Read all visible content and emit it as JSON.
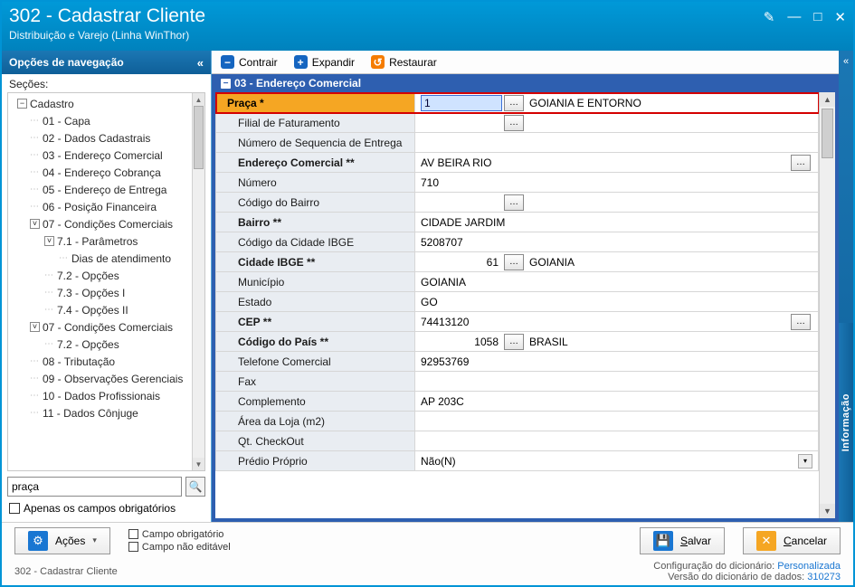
{
  "window": {
    "title": "302 - Cadastrar Cliente",
    "subtitle": "Distribuição e Varejo (Linha WinThor)"
  },
  "nav": {
    "header": "Opções de navegação",
    "sections_label": "Seções:",
    "items": [
      {
        "lv": 0,
        "exp": "-",
        "label": "Cadastro"
      },
      {
        "lv": 1,
        "label": "01 - Capa"
      },
      {
        "lv": 1,
        "label": "02 - Dados Cadastrais"
      },
      {
        "lv": 1,
        "label": "03 - Endereço Comercial"
      },
      {
        "lv": 1,
        "label": "04 - Endereço Cobrança"
      },
      {
        "lv": 1,
        "label": "05 - Endereço de Entrega"
      },
      {
        "lv": 1,
        "label": "06 - Posição Financeira"
      },
      {
        "lv": 1,
        "exp": "v",
        "label": "07 - Condições Comerciais"
      },
      {
        "lv": 2,
        "exp": "v",
        "label": "7.1 - Parâmetros"
      },
      {
        "lv": 3,
        "label": "Dias de atendimento"
      },
      {
        "lv": 2,
        "label": "7.2 - Opções"
      },
      {
        "lv": 2,
        "label": "7.3 - Opções I"
      },
      {
        "lv": 2,
        "label": "7.4 - Opções II"
      },
      {
        "lv": 1,
        "exp": "v",
        "label": "07 - Condições Comerciais"
      },
      {
        "lv": 2,
        "label": "7.2 - Opções"
      },
      {
        "lv": 1,
        "label": "08 - Tributação"
      },
      {
        "lv": 1,
        "label": "09 - Observações Gerenciais"
      },
      {
        "lv": 1,
        "label": "10 - Dados Profissionais"
      },
      {
        "lv": 1,
        "label": "11 - Dados Cônjuge"
      }
    ],
    "search_value": "praça",
    "only_required_label": "Apenas os campos obrigatórios"
  },
  "toolbar": {
    "contrair": "Contrair",
    "expandir": "Expandir",
    "restaurar": "Restaurar"
  },
  "panel": {
    "title": "03 - Endereço Comercial"
  },
  "rows": {
    "praca": {
      "label": "Praça *",
      "code": "1",
      "value": "GOIANIA E ENTORNO"
    },
    "filial": {
      "label": "Filial de Faturamento"
    },
    "numseq": {
      "label": "Número de Sequencia de Entrega"
    },
    "endcom": {
      "label": "Endereço Comercial **",
      "value": "AV BEIRA RIO"
    },
    "numero": {
      "label": "Número",
      "value": "710"
    },
    "codbairro": {
      "label": "Código do Bairro"
    },
    "bairro": {
      "label": "Bairro **",
      "value": "CIDADE JARDIM"
    },
    "codibge": {
      "label": "Código da Cidade IBGE",
      "value": "5208707"
    },
    "cidibge": {
      "label": "Cidade IBGE **",
      "code": "61",
      "value": "GOIANIA"
    },
    "municipio": {
      "label": "Município",
      "value": "GOIANIA"
    },
    "estado": {
      "label": "Estado",
      "value": "GO"
    },
    "cep": {
      "label": "CEP **",
      "value": "74413120"
    },
    "codpais": {
      "label": "Código do País **",
      "code": "1058",
      "value": "BRASIL"
    },
    "tel": {
      "label": "Telefone Comercial",
      "value": "92953769"
    },
    "fax": {
      "label": "Fax"
    },
    "compl": {
      "label": "Complemento",
      "value": "AP 203C"
    },
    "area": {
      "label": "Área da Loja (m2)"
    },
    "qtcheck": {
      "label": "Qt. CheckOut"
    },
    "predio": {
      "label": "Prédio Próprio",
      "value": "Não(N)"
    }
  },
  "footer": {
    "acoes": "Ações",
    "legend_required": "Campo obrigatório",
    "legend_readonly": "Campo não editável",
    "salvar": "Salvar",
    "cancelar": "Cancelar",
    "breadcrumb": "302 - Cadastrar Cliente",
    "dict_conf_label": "Configuração do dicionário:",
    "dict_conf_value": "Personalizada",
    "dict_ver_label": "Versão do dicionário de dados:",
    "dict_ver_value": "310273"
  },
  "info_tab": "Informação"
}
